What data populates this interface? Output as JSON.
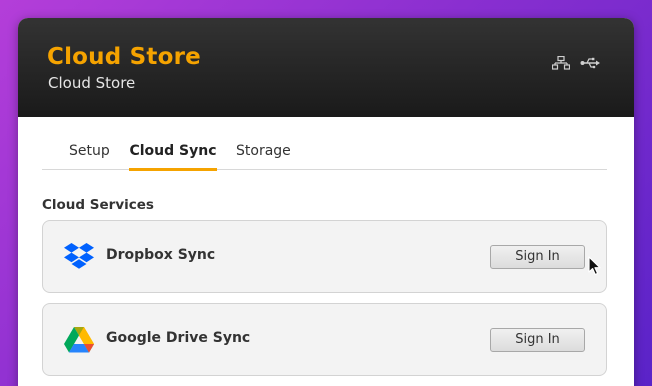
{
  "app": {
    "title": "Cloud Store",
    "subtitle": "Cloud Store",
    "header_icons": [
      "network-icon",
      "usb-icon"
    ],
    "accent_color": "#f5a300"
  },
  "tabs": [
    {
      "label": "Setup",
      "active": false
    },
    {
      "label": "Cloud Sync",
      "active": true
    },
    {
      "label": "Storage",
      "active": false
    }
  ],
  "section": {
    "title": "Cloud Services"
  },
  "services": [
    {
      "name": "Dropbox Sync",
      "icon": "dropbox-icon",
      "button_label": "Sign In"
    },
    {
      "name": "Google Drive Sync",
      "icon": "google-drive-icon",
      "button_label": "Sign In"
    }
  ]
}
